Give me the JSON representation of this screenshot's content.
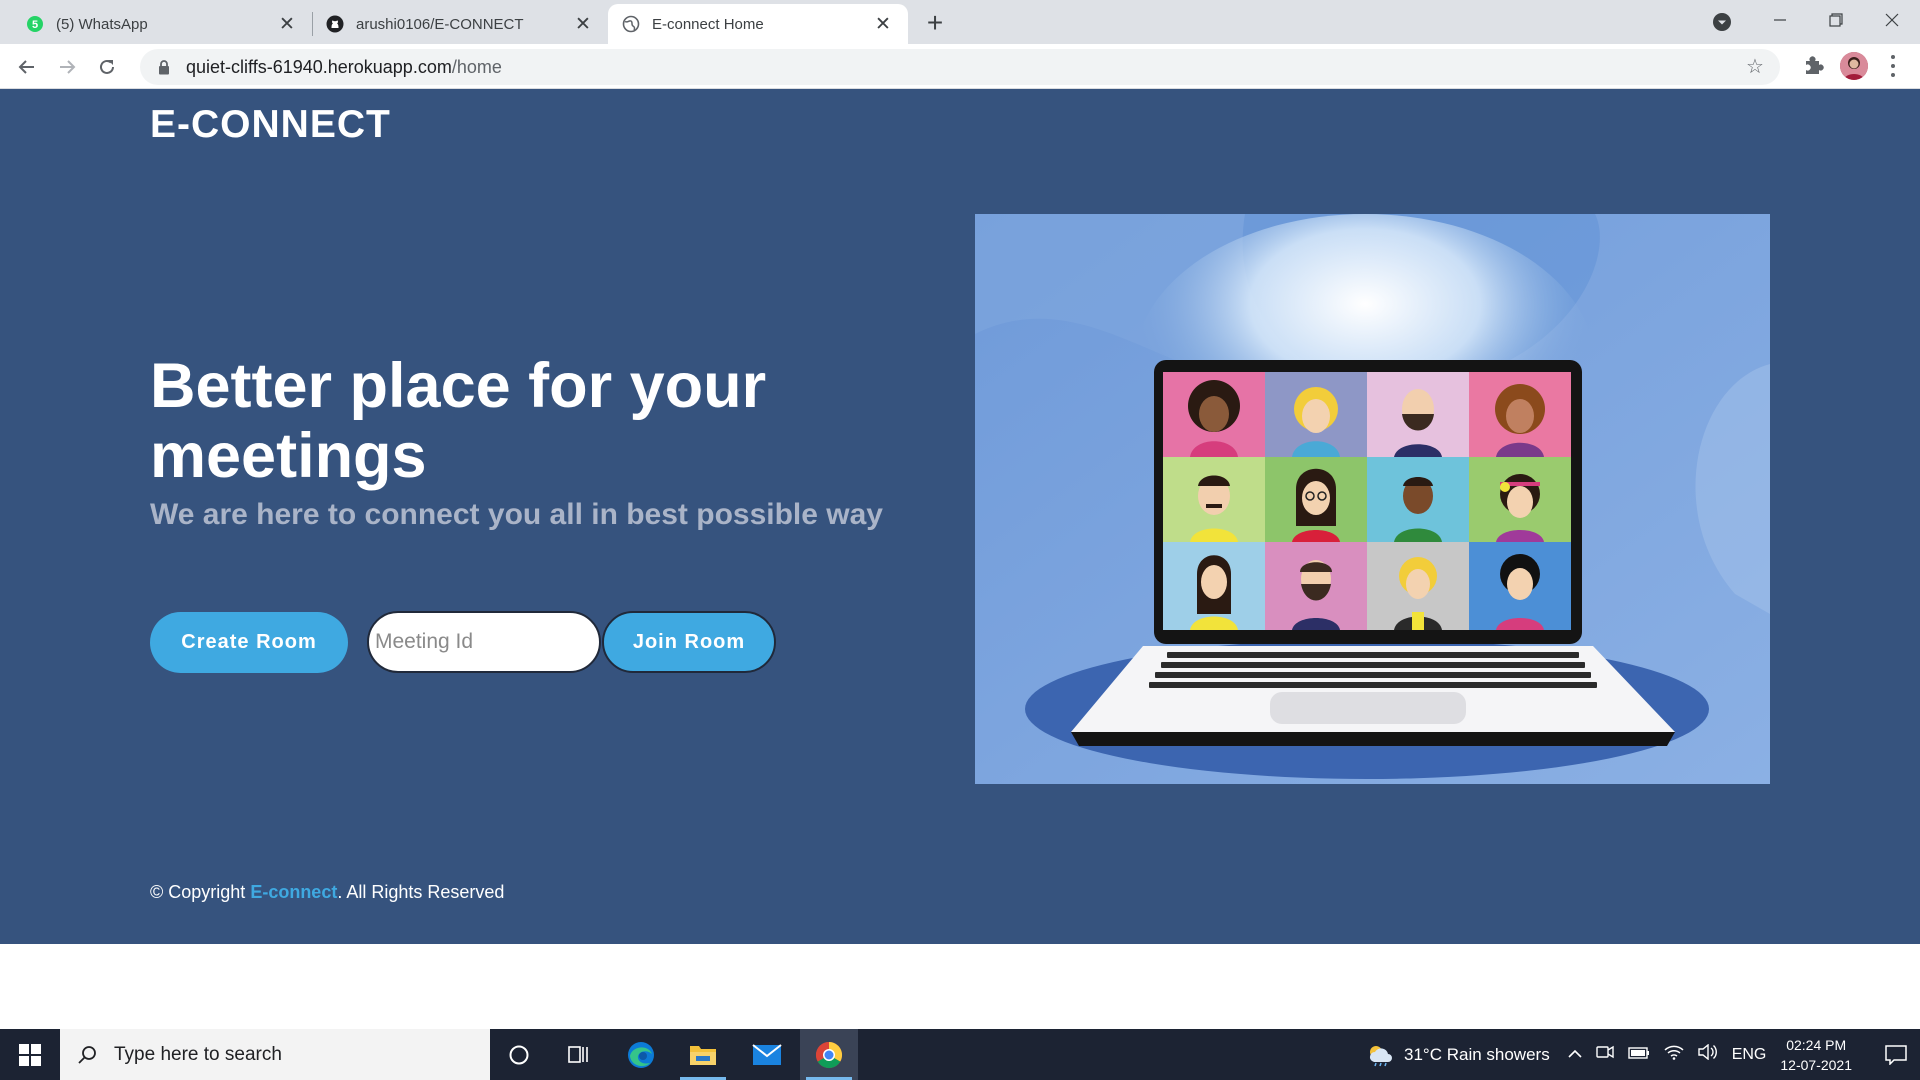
{
  "browser": {
    "tabs": [
      {
        "title": "(5) WhatsApp",
        "badge": "5",
        "active": false
      },
      {
        "title": "arushi0106/E-CONNECT",
        "active": false
      },
      {
        "title": "E-connect Home",
        "active": true
      }
    ],
    "url_host": "quiet-cliffs-61940.herokuapp.com",
    "url_path": "/home"
  },
  "page": {
    "logo": "E-CONNECT",
    "hero_title": "Better place for your meetings",
    "hero_subtitle": "We are here to connect you all in best possible way",
    "create_room_label": "Create Room",
    "meeting_id_placeholder": "Meeting Id",
    "join_room_label": "Join Room",
    "copyright_prefix": "© Copyright ",
    "copyright_brand": "E-connect",
    "copyright_suffix": ". All Rights Reserved",
    "colors": {
      "background": "#36537e",
      "accent": "#3fa9e1"
    }
  },
  "taskbar": {
    "search_placeholder": "Type here to search",
    "weather": "31°C  Rain showers",
    "language": "ENG",
    "time": "02:24 PM",
    "date": "12-07-2021",
    "apps": [
      "cortana-icon",
      "task-view-icon",
      "edge-icon",
      "file-explorer-icon",
      "mail-icon",
      "chrome-icon"
    ]
  }
}
